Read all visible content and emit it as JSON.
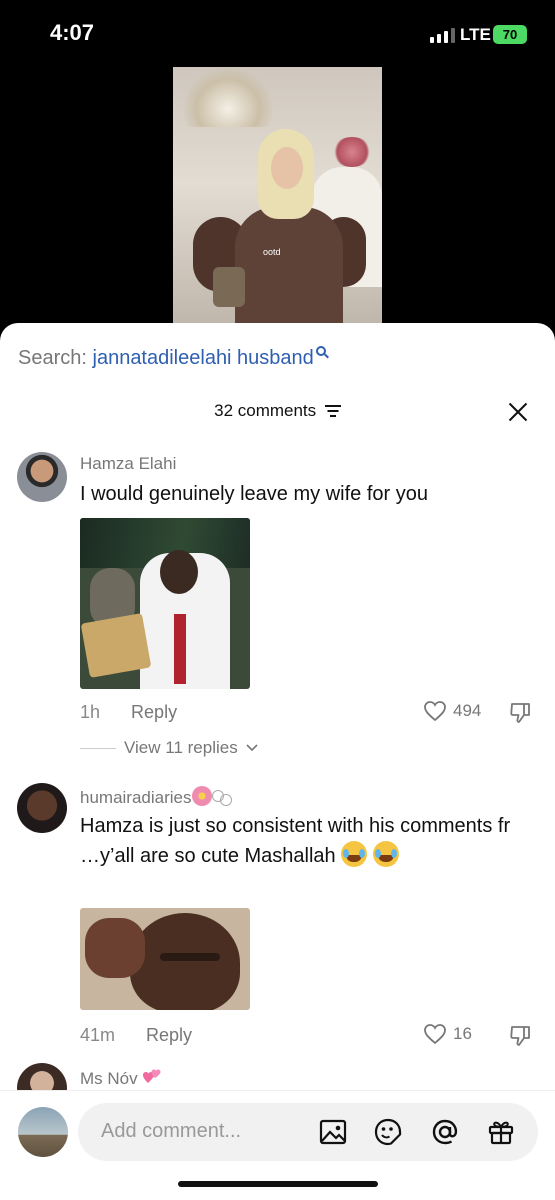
{
  "status": {
    "time": "4:07",
    "network": "LTE",
    "battery": "70"
  },
  "video": {
    "overlay_text": "ootd"
  },
  "search": {
    "label": "Search:",
    "query": "jannatadileelahi husband"
  },
  "comments_header": {
    "count_label": "32 comments"
  },
  "comments": [
    {
      "name": "Hamza Elahi",
      "text": "I would genuinely leave my wife for you",
      "time": "1h",
      "reply_label": "Reply",
      "likes": "494",
      "view_replies": "View 11 replies"
    },
    {
      "name": "humairadiaries",
      "text": "Hamza is just so consistent with his comments fr …y’all are so cute Mashallah",
      "time": "41m",
      "reply_label": "Reply",
      "likes": "16"
    },
    {
      "name": "Ms Nóv"
    }
  ],
  "bottom_bar": {
    "placeholder": "Add comment..."
  },
  "colors": {
    "accent": "#2e5fb0",
    "battery": "#4cd964",
    "sheet_bg": "#ffffff"
  }
}
